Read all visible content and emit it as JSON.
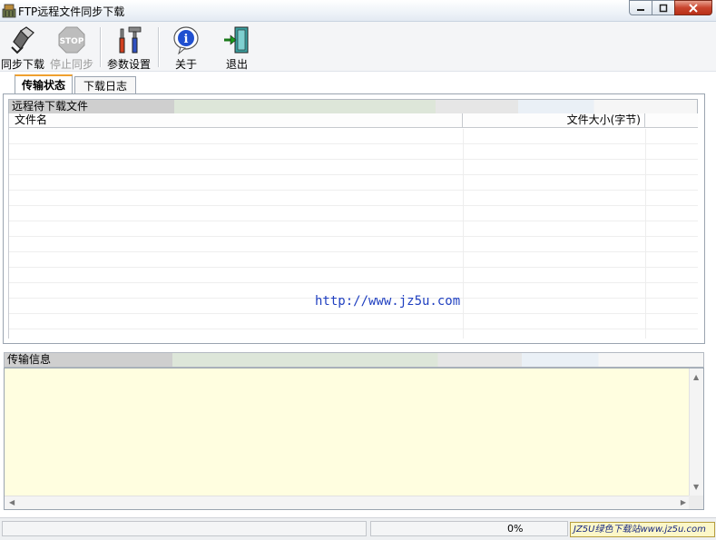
{
  "window": {
    "title": "FTP远程文件同步下载",
    "controls": [
      "minimize",
      "maximize",
      "close"
    ]
  },
  "toolbar": {
    "buttons": [
      {
        "label": "同步下载",
        "icon": "sync-download-icon",
        "enabled": true
      },
      {
        "label": "停止同步",
        "icon": "stop-icon",
        "enabled": false
      },
      {
        "label": "参数设置",
        "icon": "settings-tools-icon",
        "enabled": true
      },
      {
        "label": "关于",
        "icon": "info-icon",
        "enabled": true
      },
      {
        "label": "退出",
        "icon": "exit-door-icon",
        "enabled": true
      }
    ]
  },
  "tabs": [
    {
      "label": "传输状态",
      "active": true
    },
    {
      "label": "下载日志",
      "active": false
    }
  ],
  "remote_files": {
    "header": "远程待下载文件",
    "columns": [
      "文件名",
      "文件大小(字节)",
      ""
    ],
    "rows": []
  },
  "watermark": "http://www.jz5u.com",
  "transfer_info": {
    "header": "传输信息",
    "content": ""
  },
  "status": {
    "panel1": "",
    "panel2": "",
    "progress": "0%"
  },
  "badge": "JZ5U绿色下载站www.jz5u.com",
  "colors": {
    "memo_bg": "#fffee0",
    "active_tab_accent": "#f0a030",
    "watermark": "#2040c0"
  }
}
